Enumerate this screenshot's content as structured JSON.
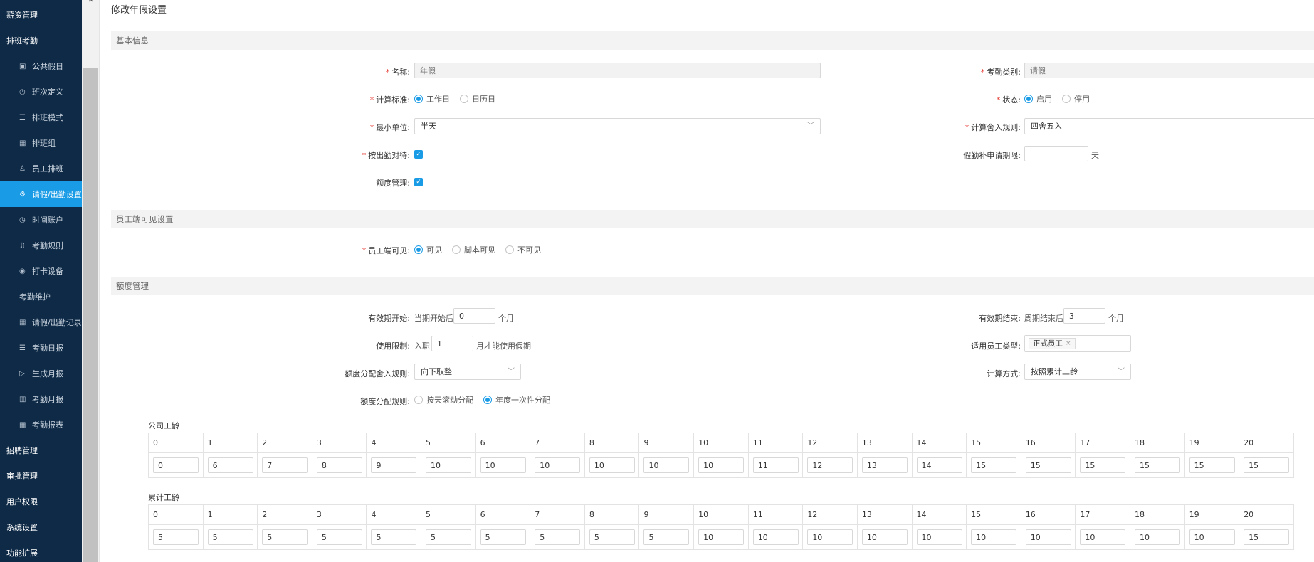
{
  "sidebar": {
    "items": [
      {
        "label": "薪资管理"
      },
      {
        "label": "排班考勤"
      },
      {
        "label": "公共假日",
        "icon": "calendar-icon"
      },
      {
        "label": "班次定义",
        "icon": "clock-icon"
      },
      {
        "label": "排班模式",
        "icon": "list-icon"
      },
      {
        "label": "排班组",
        "icon": "grid-icon"
      },
      {
        "label": "员工排班",
        "icon": "user-icon"
      },
      {
        "label": "请假/出勤设置",
        "icon": "gear-icon"
      },
      {
        "label": "时间账户",
        "icon": "clock-icon"
      },
      {
        "label": "考勤规则",
        "icon": "bell-icon"
      },
      {
        "label": "打卡设备",
        "icon": "location-icon"
      },
      {
        "label": "考勤维护"
      },
      {
        "label": "请假/出勤记录",
        "icon": "grid-icon"
      },
      {
        "label": "考勤日报",
        "icon": "list-icon"
      },
      {
        "label": "生成月报",
        "icon": "play-icon"
      },
      {
        "label": "考勤月报",
        "icon": "bar-chart-icon"
      },
      {
        "label": "考勤报表",
        "icon": "grid-icon"
      },
      {
        "label": "招聘管理"
      },
      {
        "label": "审批管理"
      },
      {
        "label": "用户权限"
      },
      {
        "label": "系统设置"
      },
      {
        "label": "功能扩展"
      }
    ],
    "active_index": 7,
    "colors": {
      "bg": "#0e2a47",
      "active": "#1a9be6"
    }
  },
  "page": {
    "title": "修改年假设置"
  },
  "basic": {
    "section": "基本信息",
    "name": {
      "label": "名称:",
      "placeholder": "年假"
    },
    "attendance_type": {
      "label": "考勤类别:",
      "placeholder": "请假"
    },
    "calc_standard": {
      "label": "计算标准:",
      "options": [
        "工作日",
        "日历日"
      ],
      "selected": 0
    },
    "status": {
      "label": "状态:",
      "options": [
        "启用",
        "停用"
      ],
      "selected": 0
    },
    "min_unit": {
      "label": "最小单位:",
      "value": "半天"
    },
    "rounding_rule": {
      "label": "计算舍入规则:",
      "value": "四舍五入"
    },
    "treat_as_attendance": {
      "label": "按出勤对待:",
      "checked": true
    },
    "supplement_period": {
      "label": "假勤补申请期限:",
      "value": "",
      "unit": "天"
    },
    "quota_mgmt": {
      "label": "额度管理:",
      "checked": true
    }
  },
  "visibility": {
    "section": "员工端可见设置",
    "label": "员工端可见:",
    "options": [
      "可见",
      "脚本可见",
      "不可见"
    ],
    "selected": 0
  },
  "quota": {
    "section": "额度管理",
    "valid_start": {
      "label": "有效期开始:",
      "prefix": "当期开始后",
      "value": "0",
      "unit": "个月"
    },
    "valid_end": {
      "label": "有效期结束:",
      "prefix": "周期结束后",
      "value": "3",
      "unit": "个月"
    },
    "usage_limit": {
      "label": "使用限制:",
      "prefix": "入职",
      "value": "1",
      "suffix": "月才能使用假期"
    },
    "employee_types": {
      "label": "适用员工类型:",
      "tags": [
        "正式员工"
      ]
    },
    "alloc_rounding": {
      "label": "额度分配舍入规则:",
      "value": "向下取整"
    },
    "calc_method": {
      "label": "计算方式:",
      "value": "按照累计工龄"
    },
    "alloc_rule": {
      "label": "额度分配规则:",
      "options": [
        "按天滚动分配",
        "年度一次性分配"
      ],
      "selected": 1
    }
  },
  "company_seniority": {
    "title": "公司工龄",
    "years": [
      "0",
      "1",
      "2",
      "3",
      "4",
      "5",
      "6",
      "7",
      "8",
      "9",
      "10",
      "11",
      "12",
      "13",
      "14",
      "15",
      "16",
      "17",
      "18",
      "19",
      "20"
    ],
    "values": [
      "0",
      "6",
      "7",
      "8",
      "9",
      "10",
      "10",
      "10",
      "10",
      "10",
      "10",
      "11",
      "12",
      "13",
      "14",
      "15",
      "15",
      "15",
      "15",
      "15",
      "15"
    ]
  },
  "total_seniority": {
    "title": "累计工龄",
    "years": [
      "0",
      "1",
      "2",
      "3",
      "4",
      "5",
      "6",
      "7",
      "8",
      "9",
      "10",
      "11",
      "12",
      "13",
      "14",
      "15",
      "16",
      "17",
      "18",
      "19",
      "20"
    ],
    "values": [
      "5",
      "5",
      "5",
      "5",
      "5",
      "5",
      "5",
      "5",
      "5",
      "5",
      "10",
      "10",
      "10",
      "10",
      "10",
      "10",
      "10",
      "10",
      "10",
      "10",
      "15"
    ]
  }
}
